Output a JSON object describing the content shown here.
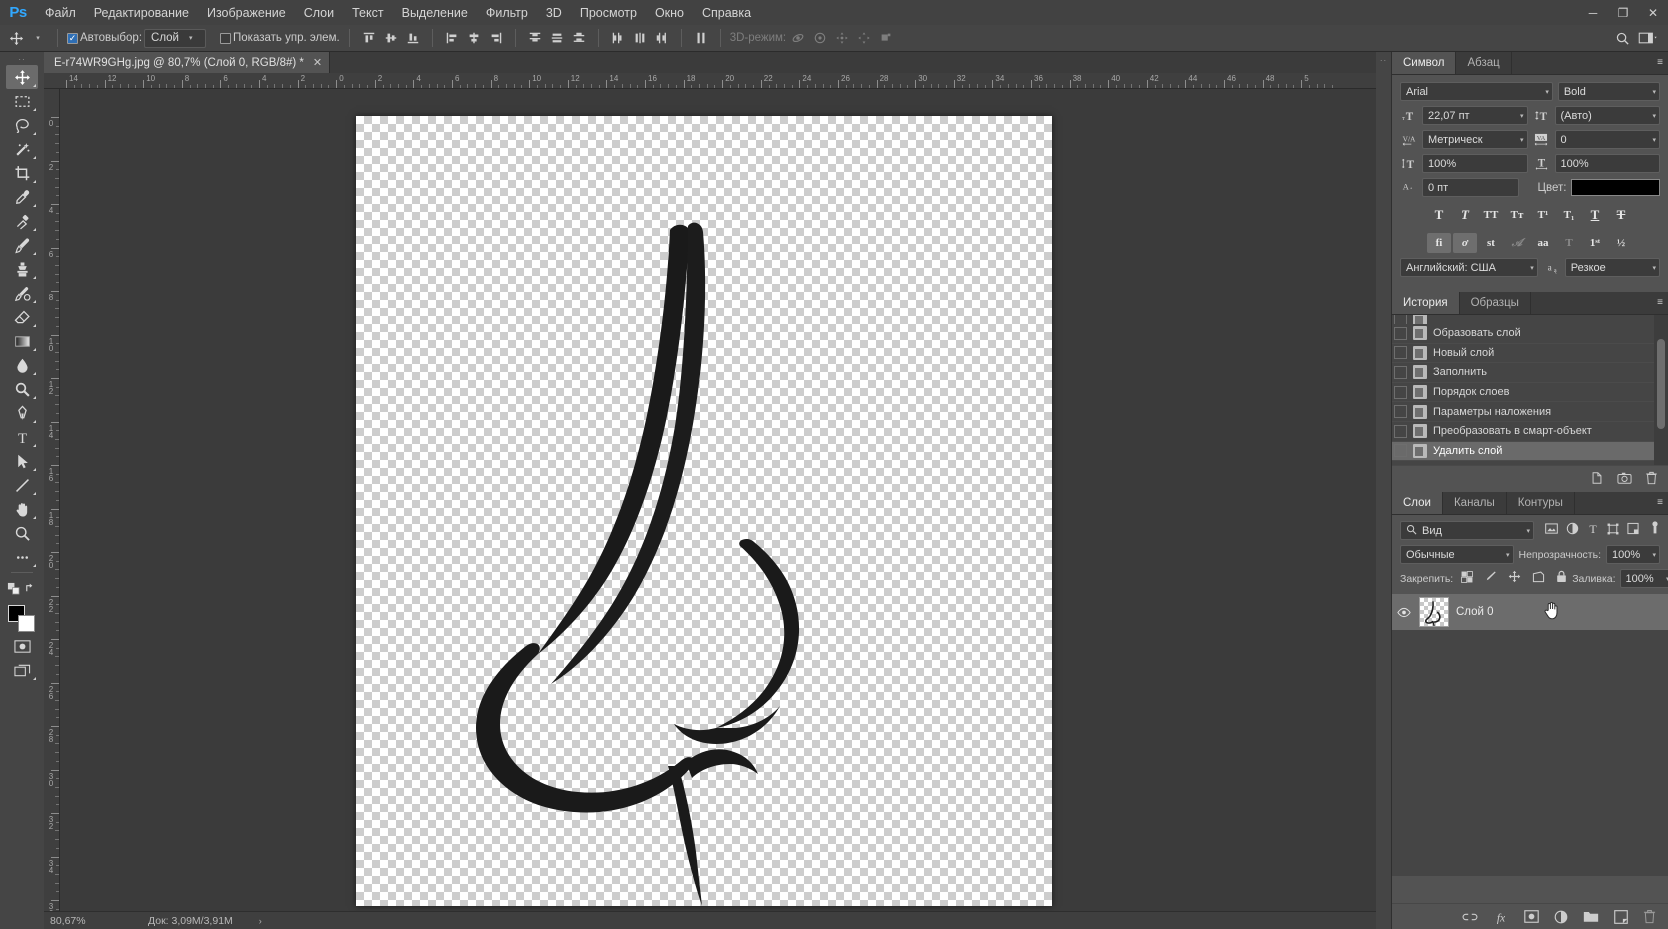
{
  "app": {
    "name": "Photoshop",
    "logo": "Ps",
    "logo_color": "#31a8ff"
  },
  "menubar": {
    "items": [
      {
        "label": "Файл"
      },
      {
        "label": "Редактирование"
      },
      {
        "label": "Изображение"
      },
      {
        "label": "Слои"
      },
      {
        "label": "Текст"
      },
      {
        "label": "Выделение"
      },
      {
        "label": "Фильтр"
      },
      {
        "label": "3D"
      },
      {
        "label": "Просмотр"
      },
      {
        "label": "Окно"
      },
      {
        "label": "Справка"
      }
    ],
    "window_buttons": {
      "minimize": "─",
      "restore": "❐",
      "close": "✕"
    }
  },
  "options_bar": {
    "tool_icon": "move-icon",
    "auto_select_label": "Автовыбор:",
    "auto_select_checked": true,
    "auto_select_value": "Слой",
    "show_transform_label": "Показать упр. элем.",
    "show_transform_checked": false,
    "mode_3d_label": "3D-режим:",
    "align_group_1": [
      "align-top-edges-icon",
      "align-vertical-centers-icon",
      "align-bottom-edges-icon"
    ],
    "align_group_2": [
      "align-left-edges-icon",
      "align-horizontal-centers-icon",
      "align-right-edges-icon"
    ],
    "distribute_group_1": [
      "distribute-top-icon",
      "distribute-vertical-center-icon",
      "distribute-bottom-icon"
    ],
    "distribute_group_2": [
      "distribute-left-icon",
      "distribute-horizontal-center-icon",
      "distribute-right-icon"
    ],
    "distribute_spacing": "distribute-spacing-icon",
    "mode_3d_icons": [
      "orbit-3d-icon",
      "roll-3d-icon",
      "pan-3d-icon",
      "slide-3d-icon",
      "scale-3d-icon"
    ],
    "right_icons": [
      "search-icon",
      "workspace-switcher-icon"
    ]
  },
  "document_tab": {
    "title": "E-r74WR9GHg.jpg @ 80,7% (Слой 0, RGB/8#) *",
    "close_glyph": "✕"
  },
  "toolbar": {
    "grip": "··",
    "tools": [
      {
        "name": "move-tool",
        "icon": "move-icon",
        "active": true,
        "has_flyout": true
      },
      {
        "name": "rectangular-marquee-tool",
        "icon": "marquee-icon",
        "active": false,
        "has_flyout": true
      },
      {
        "name": "lasso-tool",
        "icon": "lasso-icon",
        "active": false,
        "has_flyout": true
      },
      {
        "name": "quick-selection-tool",
        "icon": "magic-wand-icon",
        "active": false,
        "has_flyout": true
      },
      {
        "name": "crop-tool",
        "icon": "crop-icon",
        "active": false,
        "has_flyout": true
      },
      {
        "name": "eyedropper-tool",
        "icon": "eyedropper-icon",
        "active": false,
        "has_flyout": true
      },
      {
        "name": "spot-healing-brush-tool",
        "icon": "healing-brush-icon",
        "active": false,
        "has_flyout": true
      },
      {
        "name": "brush-tool",
        "icon": "brush-icon",
        "active": false,
        "has_flyout": true
      },
      {
        "name": "clone-stamp-tool",
        "icon": "clone-stamp-icon",
        "active": false,
        "has_flyout": true
      },
      {
        "name": "history-brush-tool",
        "icon": "history-brush-icon",
        "active": false,
        "has_flyout": true
      },
      {
        "name": "eraser-tool",
        "icon": "eraser-icon",
        "active": false,
        "has_flyout": true
      },
      {
        "name": "gradient-tool",
        "icon": "gradient-icon",
        "active": false,
        "has_flyout": true
      },
      {
        "name": "blur-tool",
        "icon": "blur-drop-icon",
        "active": false,
        "has_flyout": true
      },
      {
        "name": "dodge-tool",
        "icon": "dodge-icon",
        "active": false,
        "has_flyout": true
      },
      {
        "name": "pen-tool",
        "icon": "pen-icon",
        "active": false,
        "has_flyout": true
      },
      {
        "name": "type-tool",
        "icon": "type-icon",
        "active": false,
        "has_flyout": true
      },
      {
        "name": "path-selection-tool",
        "icon": "path-arrow-icon",
        "active": false,
        "has_flyout": true
      },
      {
        "name": "line-tool",
        "icon": "line-icon",
        "active": false,
        "has_flyout": true
      },
      {
        "name": "hand-tool",
        "icon": "hand-icon",
        "active": false,
        "has_flyout": true
      },
      {
        "name": "zoom-tool",
        "icon": "zoom-icon",
        "active": false,
        "has_flyout": false
      },
      {
        "name": "edit-toolbar",
        "icon": "ellipsis-icon",
        "active": false,
        "has_flyout": true
      }
    ],
    "swap_colors_icon": "swap-colors-icon",
    "default_colors_icon": "default-colors-icon",
    "foreground_color": "#000000",
    "background_color": "#ffffff",
    "quick_mask_icon": "quick-mask-icon",
    "screen_mode_icon": "screen-mode-icon"
  },
  "rulers": {
    "horizontal_labels": [
      "14",
      "12",
      "10",
      "8",
      "6",
      "4",
      "2",
      "0",
      "2",
      "4",
      "6",
      "8",
      "10",
      "12",
      "14",
      "16",
      "18",
      "20",
      "22",
      "24",
      "26",
      "28",
      "30",
      "32",
      "34",
      "36",
      "38",
      "40",
      "42",
      "44",
      "46",
      "48",
      "5"
    ],
    "vertical_labels": [
      "0",
      "2",
      "4",
      "6",
      "8",
      "10",
      "12",
      "14",
      "16",
      "18",
      "20",
      "22",
      "24",
      "26",
      "28",
      "30",
      "32",
      "34",
      "36"
    ]
  },
  "canvas": {
    "artwork_name": "nose-line-art",
    "artwork_color": "#1a1a1a",
    "background": "transparent-checkerboard"
  },
  "character_panel": {
    "tabs": [
      {
        "label": "Символ",
        "active": true
      },
      {
        "label": "Абзац",
        "active": false
      }
    ],
    "font_family": "Arial",
    "font_style": "Bold",
    "font_size_icon": "font-size-icon",
    "font_size": "22,07 пт",
    "leading_icon": "leading-icon",
    "leading": "(Авто)",
    "kerning_icon": "kerning-icon",
    "kerning": "Метрическ",
    "tracking_icon": "tracking-icon",
    "tracking": "0",
    "vertical_scale_icon": "vertical-scale-icon",
    "vertical_scale": "100%",
    "horizontal_scale_icon": "horizontal-scale-icon",
    "horizontal_scale": "100%",
    "baseline_icon": "baseline-shift-icon",
    "baseline_shift": "0 пт",
    "color_label": "Цвет:",
    "color_value": "#000000",
    "style_glyphs": [
      {
        "name": "faux-bold",
        "glyph": "T",
        "state": "normal"
      },
      {
        "name": "faux-italic",
        "glyph": "T",
        "state": "italic"
      },
      {
        "name": "all-caps",
        "glyph": "TT",
        "state": "normal"
      },
      {
        "name": "small-caps",
        "glyph": "Tт",
        "state": "normal"
      },
      {
        "name": "superscript",
        "glyph": "T¹",
        "state": "normal"
      },
      {
        "name": "subscript",
        "glyph": "T₁",
        "state": "normal"
      },
      {
        "name": "underline",
        "glyph": "T",
        "state": "underline"
      },
      {
        "name": "strikethrough",
        "glyph": "T",
        "state": "strike"
      }
    ],
    "opentype_glyphs": [
      {
        "name": "standard-ligatures",
        "glyph": "fi",
        "active": true
      },
      {
        "name": "contextual-alternates",
        "glyph": "ơ",
        "active": true
      },
      {
        "name": "discretionary-ligatures",
        "glyph": "st",
        "active": false
      },
      {
        "name": "swash",
        "glyph": "𝒜",
        "active": false,
        "dim": true
      },
      {
        "name": "oldstyle",
        "glyph": "aa",
        "active": false
      },
      {
        "name": "stylistic-alternates",
        "glyph": "T",
        "active": false,
        "dim": true
      },
      {
        "name": "ordinals",
        "glyph": "1ˢᵗ",
        "active": false
      },
      {
        "name": "fractions",
        "glyph": "½",
        "active": false
      }
    ],
    "language": "Английский: США",
    "antialias_icon": "antialias-icon",
    "antialias": "Резкое"
  },
  "history_panel": {
    "tabs": [
      {
        "label": "История",
        "active": true
      },
      {
        "label": "Образцы",
        "active": false
      }
    ],
    "items": [
      {
        "label": "Образовать слой",
        "selected": false,
        "icon": "layer-state-icon"
      },
      {
        "label": "Новый слой",
        "selected": false,
        "icon": "layer-state-icon"
      },
      {
        "label": "Заполнить",
        "selected": false,
        "icon": "fill-state-icon"
      },
      {
        "label": "Порядок слоев",
        "selected": false,
        "icon": "layer-state-icon"
      },
      {
        "label": "Параметры наложения",
        "selected": false,
        "icon": "layer-state-icon"
      },
      {
        "label": "Преобразовать в смарт-объект",
        "selected": false,
        "icon": "layer-state-icon"
      },
      {
        "label": "Удалить слой",
        "selected": true,
        "icon": "layer-state-icon"
      }
    ],
    "footer_icons": [
      "create-document-from-state-icon",
      "create-snapshot-icon",
      "delete-state-icon"
    ]
  },
  "layers_panel": {
    "tabs": [
      {
        "label": "Слои",
        "active": true
      },
      {
        "label": "Каналы",
        "active": false
      },
      {
        "label": "Контуры",
        "active": false
      }
    ],
    "filter_icon": "search-icon",
    "filter_value": "Вид",
    "filter_type_icons": [
      "filter-pixel-icon",
      "filter-adjustment-icon",
      "filter-type-icon",
      "filter-shape-icon",
      "filter-smart-object-icon"
    ],
    "filter_toggle_icon": "filter-toggle-icon",
    "blend_mode": "Обычные",
    "opacity_label": "Непрозрачность:",
    "opacity_value": "100%",
    "lock_label": "Закрепить:",
    "lock_icons": [
      "lock-transparent-pixels-icon",
      "lock-image-pixels-icon",
      "lock-position-icon",
      "lock-artboard-nesting-icon",
      "lock-all-icon"
    ],
    "fill_label": "Заливка:",
    "fill_value": "100%",
    "layers": [
      {
        "name": "Слой 0",
        "visible": true,
        "selected": true,
        "visibility_icon": "eye-icon",
        "thumbnail": "transparent-checkerboard-nose-thumb"
      }
    ],
    "cursor_icon": "hand-cursor-icon",
    "footer_icons": [
      "link-layers-icon",
      "layer-style-fx-icon",
      "add-layer-mask-icon",
      "new-adjustment-layer-icon",
      "new-group-icon",
      "new-layer-icon",
      "delete-layer-icon"
    ]
  },
  "status_bar": {
    "zoom": "80,67%",
    "doc_info": "Док: 3,09M/3,91M",
    "expand_glyph": "›"
  }
}
